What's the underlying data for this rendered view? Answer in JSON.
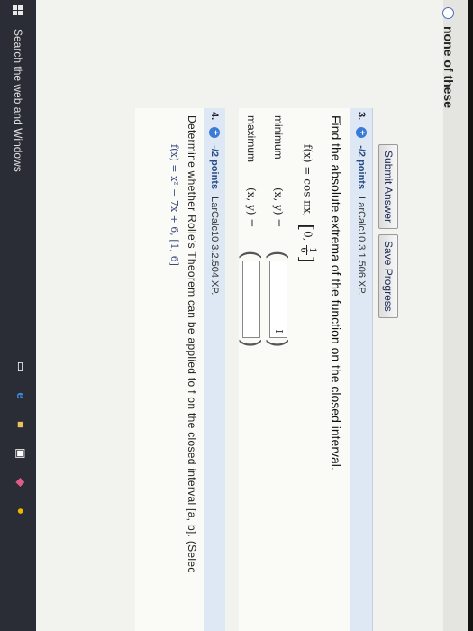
{
  "prev_question": {
    "option_label": "none of these"
  },
  "buttons": {
    "submit_label": "Submit Answer",
    "save_label": "Save Progress"
  },
  "q3": {
    "number": "3.",
    "points": "-/2 points",
    "source": "LarCalc10 3.1.506.XP.",
    "prompt": "Find the absolute extrema of the function on the closed interval.",
    "function": "f(x) = cos πx,",
    "interval_left": "0,",
    "interval_num": "1",
    "interval_den": "6",
    "minimum_label": "minimum",
    "maximum_label": "maximum",
    "pair_label": "(x, y) =",
    "minimum_value": "I",
    "maximum_value": ""
  },
  "q4": {
    "number": "4.",
    "points": "-/2 points",
    "source": "LarCalc10 3.2.504.XP.",
    "prompt": "Determine whether Rolle's Theorem can be applied to f on the closed interval [a, b]. (Selec",
    "function": "f(x) = x² − 7x + 6,   [1, 6]"
  },
  "taskbar": {
    "search_placeholder": "Search the web and Windows"
  },
  "colors": {
    "accent": "#3a7bd5",
    "header_bar": "#dde8f4",
    "taskbar": "#2a2d36"
  }
}
